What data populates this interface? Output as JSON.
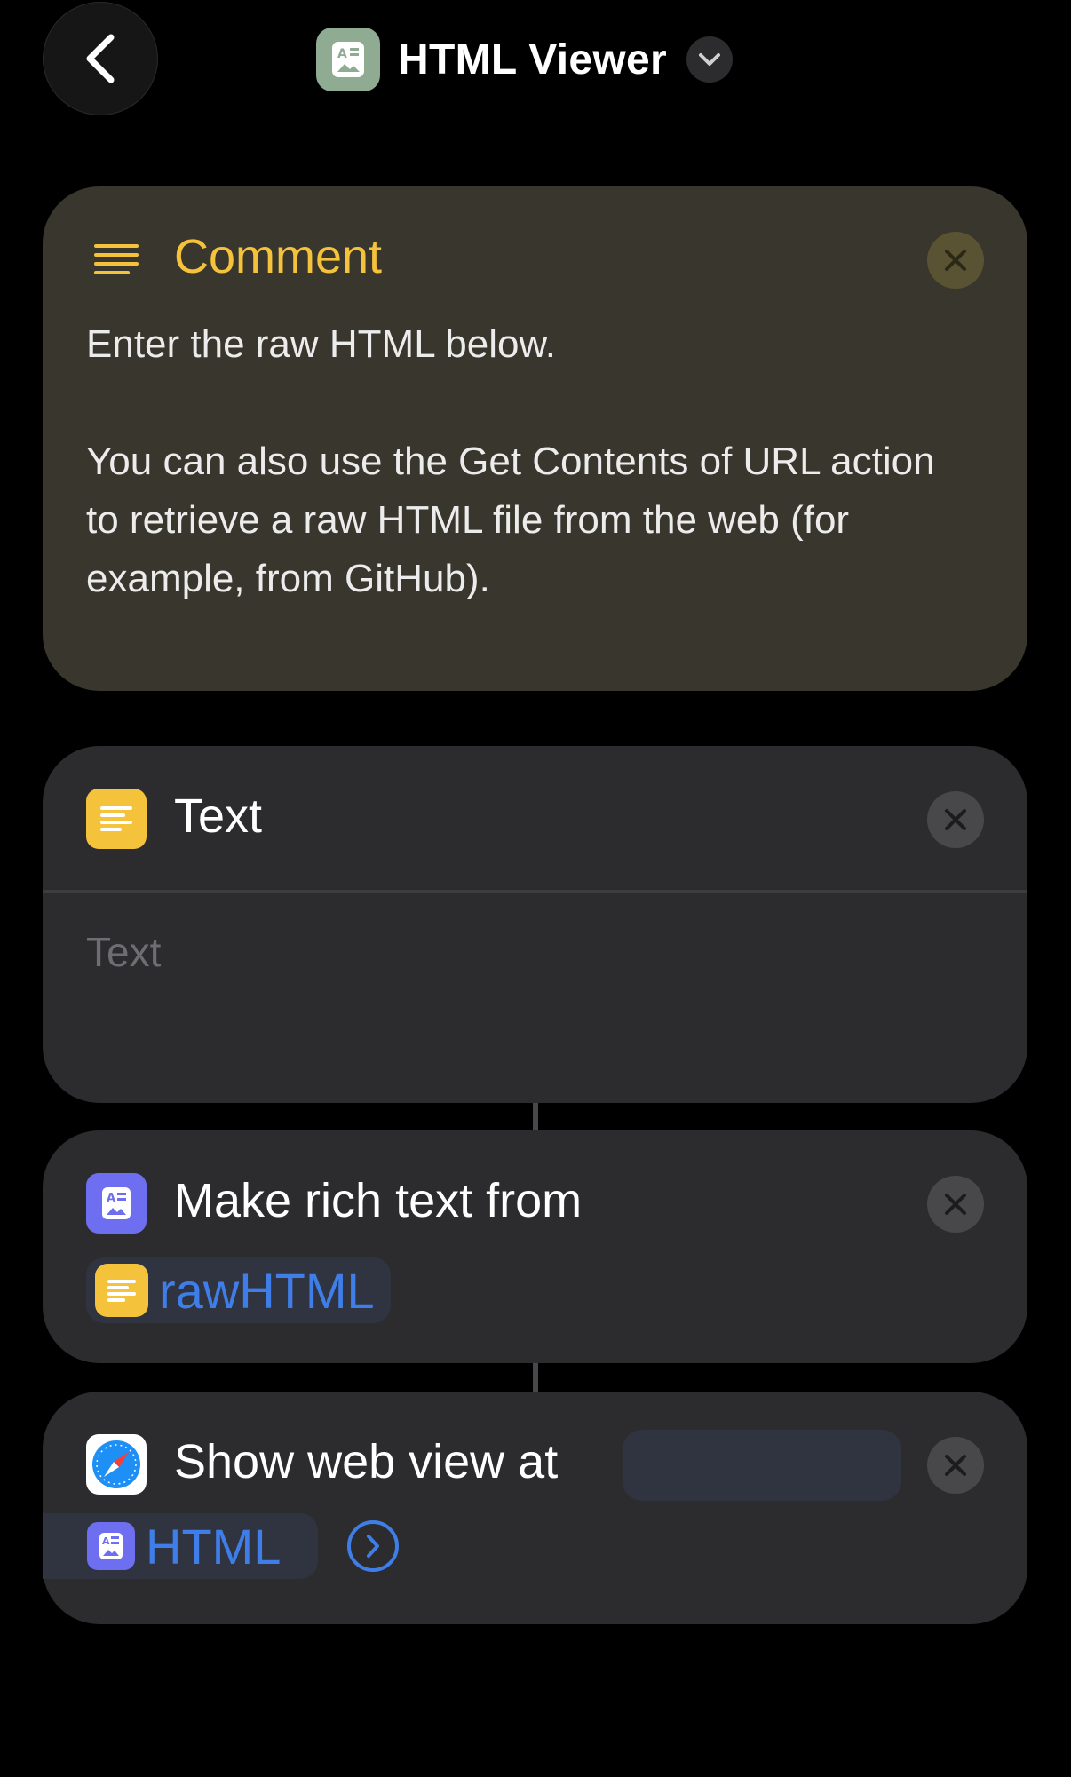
{
  "header": {
    "back_icon": "chevron-left-icon",
    "app_icon": "document-image-icon",
    "title": "HTML Viewer",
    "menu_icon": "chevron-down-icon"
  },
  "comment": {
    "icon": "lines-icon",
    "title": "Comment",
    "body": [
      "Enter the raw HTML below.",
      "You can also use the Get Contents of URL action to retrieve a raw HTML file from the web (for example, from GitHub)."
    ],
    "accent": "#f5c33b"
  },
  "text_action": {
    "icon": "text-lines-icon",
    "title": "Text",
    "placeholder": "Text",
    "icon_color": "#f5c33b"
  },
  "rich_text_action": {
    "icon": "document-image-icon",
    "title": "Make rich text from",
    "variable_icon": "text-lines-icon",
    "variable": "rawHTML",
    "icon_color": "#6e6ff0"
  },
  "web_view_action": {
    "icon": "safari-compass-icon",
    "title": "Show web view at",
    "variable_icon": "document-image-icon",
    "variable": "HTML",
    "go_icon": "chevron-right-circle-icon",
    "link_color": "#3f7ee8"
  }
}
